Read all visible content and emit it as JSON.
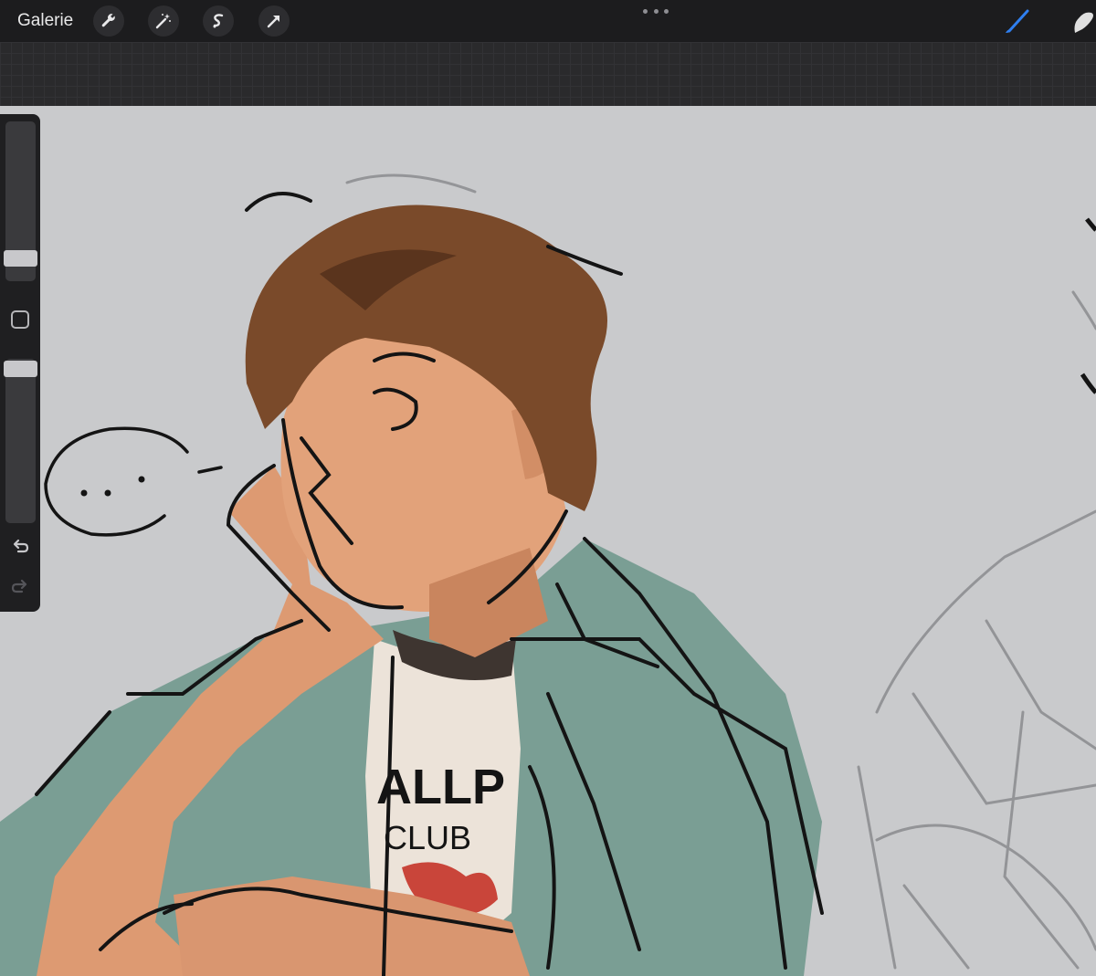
{
  "toolbar": {
    "gallery_label": "Galerie",
    "tools": [
      {
        "name": "wrench-icon"
      },
      {
        "name": "magic-wand-icon"
      },
      {
        "name": "selection-icon"
      },
      {
        "name": "transform-arrow-icon"
      }
    ],
    "more_icon": "ellipsis-icon",
    "right_tools": [
      {
        "name": "brush-icon",
        "color": "#2f7ff0"
      },
      {
        "name": "smudge-icon",
        "color": "#e0e0e0"
      }
    ]
  },
  "sidebar": {
    "brush_size_level": 0.73,
    "opacity_level": 1.0,
    "modifier_icon": "square-modifier-icon",
    "undo_icon": "undo-icon",
    "redo_icon": "redo-icon"
  },
  "canvas": {
    "background": "#c9cacc",
    "drawing_text": {
      "shirt_top": "ALLP",
      "shirt_bottom": "CLUB",
      "speech": ". . ."
    }
  }
}
